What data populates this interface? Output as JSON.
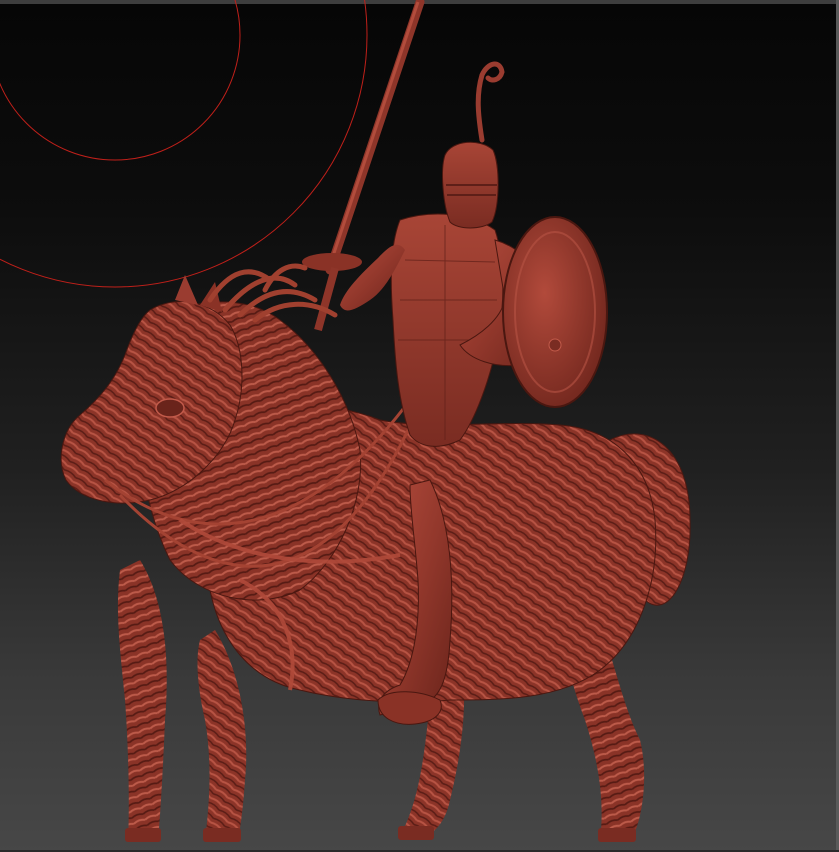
{
  "viewport": {
    "background_top": "#060606",
    "background_bottom": "#474747"
  },
  "gizmo": {
    "color": "#c0201a"
  },
  "model": {
    "material_color": "#9a3c30",
    "shadow_color": "#5e1f18",
    "highlight_color": "#c25a4a"
  }
}
